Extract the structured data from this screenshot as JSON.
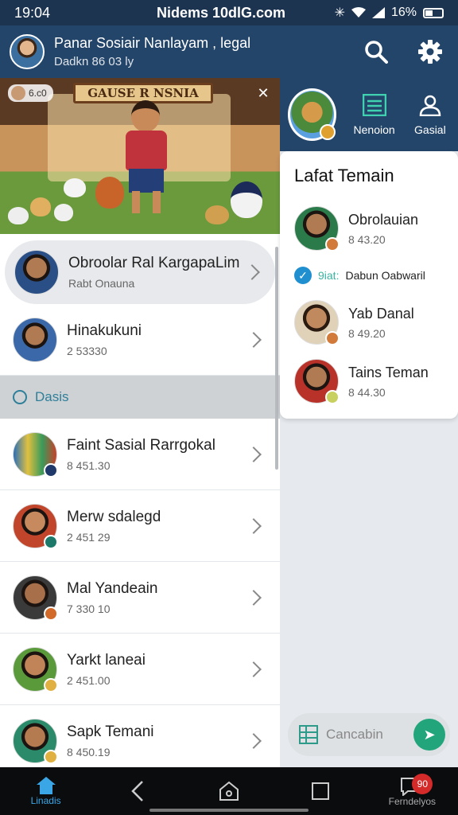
{
  "status_bar": {
    "time": "19:04",
    "carrier": "Nidems 10dlG.com",
    "battery": "16%"
  },
  "header": {
    "title": "Panar Sosiair Nanlayam , legal",
    "subtitle": "Dadkn 86 03 ly"
  },
  "banner": {
    "sign": "GAUSE R NSNIA",
    "badge": "6.c0"
  },
  "right_tabs": [
    {
      "label": "Nenoion"
    },
    {
      "label": "Gasial"
    }
  ],
  "left_list": {
    "selected": {
      "name": "Obroolar Ral KargapaLim",
      "sub": "Rabt Onauna"
    },
    "top": [
      {
        "name": "Hinakukuni",
        "sub": "2 53330"
      }
    ],
    "section_label": "Dasis",
    "items": [
      {
        "name": "Faint Sasial Rarrgokal",
        "sub": "8 451.30"
      },
      {
        "name": "Merw sdalegd",
        "sub": "2 451 29"
      },
      {
        "name": "Mal Yandeain",
        "sub": "7 330 10"
      },
      {
        "name": "Yarkt laneai",
        "sub": "2 451.00"
      },
      {
        "name": "Sapk Temani",
        "sub": "8 450.19"
      }
    ]
  },
  "card": {
    "title": "Lafat Temain",
    "items": [
      {
        "name": "Obrolauian",
        "sub": "8 43.20"
      },
      {
        "name": "Yab Danal",
        "sub": "8 49.20"
      },
      {
        "name": "Tains Teman",
        "sub": "8 44.30"
      }
    ],
    "mid_line": {
      "prefix": "9iat:",
      "text": "Dabun Oabwaril"
    }
  },
  "search": {
    "placeholder": "Cancabin"
  },
  "bottom_nav": {
    "home": "Linadis",
    "right": "Ferndelyos",
    "badge": "90"
  },
  "colors": {
    "header": "#24456a",
    "status": "#1d3450",
    "accent": "#22a57a"
  }
}
